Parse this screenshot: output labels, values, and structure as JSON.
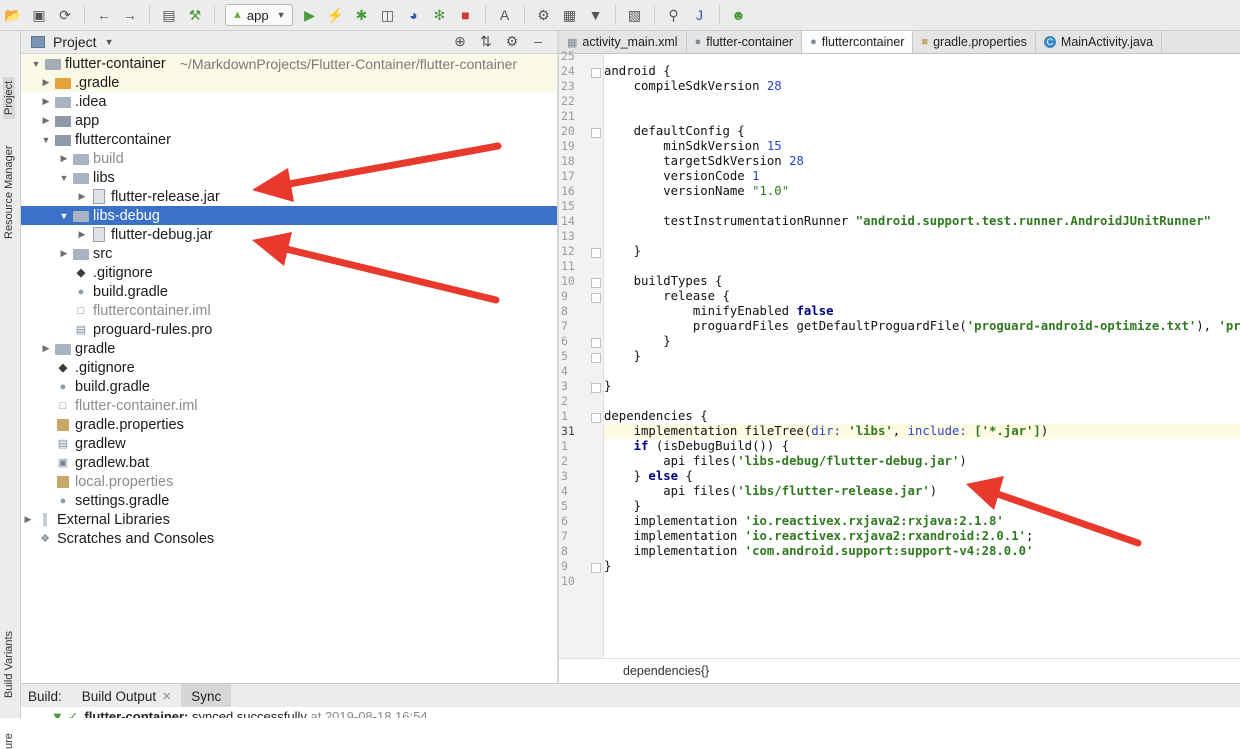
{
  "toolbar": {
    "run_config": "app"
  },
  "left_strip": {
    "project_tab": "Project",
    "resource_manager_tab": "Resource Manager",
    "build_variants_tab": "Build Variants",
    "bottom_tab": "ure"
  },
  "project_panel": {
    "title": "Project"
  },
  "tree": [
    {
      "label": "flutter-container",
      "note": "~/MarkdownProjects/Flutter-Container/flutter-container"
    },
    {
      "label": ".gradle"
    },
    {
      "label": ".idea"
    },
    {
      "label": "app"
    },
    {
      "label": "fluttercontainer"
    },
    {
      "label": "build"
    },
    {
      "label": "libs"
    },
    {
      "label": "flutter-release.jar"
    },
    {
      "label": "libs-debug"
    },
    {
      "label": "flutter-debug.jar"
    },
    {
      "label": "src"
    },
    {
      "label": ".gitignore"
    },
    {
      "label": "build.gradle"
    },
    {
      "label": "fluttercontainer.iml"
    },
    {
      "label": "proguard-rules.pro"
    },
    {
      "label": "gradle"
    },
    {
      "label": ".gitignore"
    },
    {
      "label": "build.gradle"
    },
    {
      "label": "flutter-container.iml"
    },
    {
      "label": "gradle.properties"
    },
    {
      "label": "gradlew"
    },
    {
      "label": "gradlew.bat"
    },
    {
      "label": "local.properties"
    },
    {
      "label": "settings.gradle"
    },
    {
      "label": "External Libraries"
    },
    {
      "label": "Scratches and Consoles"
    }
  ],
  "editor_tabs": [
    "activity_main.xml",
    "flutter-container",
    "fluttercontainer",
    "gradle.properties",
    "MainActivity.java"
  ],
  "line_numbers": [
    "25",
    "24",
    "23",
    "22",
    "21",
    "20",
    "19",
    "18",
    "17",
    "16",
    "15",
    "14",
    "13",
    "12",
    "11",
    "10",
    "9",
    "8",
    "7",
    "6",
    "5",
    "4",
    "3",
    "2",
    "1",
    "31",
    "1",
    "2",
    "3",
    "4",
    "5",
    "6",
    "7",
    "8",
    "9",
    "10"
  ],
  "code": {
    "l1": "android {",
    "l2a": "    compileSdkVersion ",
    "l2b": "28",
    "l5": "    defaultConfig {",
    "l6a": "        minSdkVersion ",
    "l6b": "15",
    "l7a": "        targetSdkVersion ",
    "l7b": "28",
    "l8a": "        versionCode ",
    "l8b": "1",
    "l9a": "        versionName ",
    "l9b": "\"1.0\"",
    "l11a": "        testInstrumentationRunner ",
    "l11b": "\"android.support.test.runner.AndroidJUnitRunner\"",
    "l13": "    }",
    "l15": "    buildTypes {",
    "l16": "        release {",
    "l17a": "            minifyEnabled ",
    "l17b": "false",
    "l18a": "            proguardFiles getDefaultProguardFile(",
    "l18b": "'proguard-android-optimize.txt'",
    "l18c": "), ",
    "l18d": "'progua",
    "l19": "        }",
    "l20": "    }",
    "l22": "}",
    "l24": "dependencies {",
    "l25a": "    implementation fileTree(",
    "l25b": "dir: ",
    "l25c": "'libs'",
    "l25d": ", ",
    "l25e": "include: ",
    "l25f": "['*.jar']",
    "l25g": ")",
    "l26a": "    ",
    "l26b": "if",
    "l26c": " (isDebugBuild()) {",
    "l27a": "        api files(",
    "l27b": "'libs-debug/flutter-debug.jar'",
    "l27c": ")",
    "l28a": "    } ",
    "l28b": "else",
    "l28c": " {",
    "l29a": "        api files(",
    "l29b": "'libs/flutter-release.jar'",
    "l29c": ")",
    "l30": "    }",
    "l31a": "    implementation ",
    "l31b": "'io.reactivex.rxjava2:rxjava:2.1.8'",
    "l32a": "    implementation ",
    "l32b": "'io.reactivex.rxjava2:rxandroid:2.0.1'",
    "l32c": ";",
    "l33a": "    implementation ",
    "l33b": "'com.android.support:support-v4:28.0.0'",
    "l34": "}"
  },
  "breadcrumb": "dependencies{}",
  "build_panel": {
    "label": "Build:",
    "tab_output": "Build Output",
    "tab_sync": "Sync",
    "message_project": "flutter-container:",
    "message_text": " synced successfully",
    "message_time": " at 2019-08-18 16:54"
  },
  "colors": {
    "selection": "#3c71c8",
    "arrow": "#e8392c",
    "string": "#2f7a1e",
    "keyword": "#000080",
    "number": "#2a45c9"
  }
}
